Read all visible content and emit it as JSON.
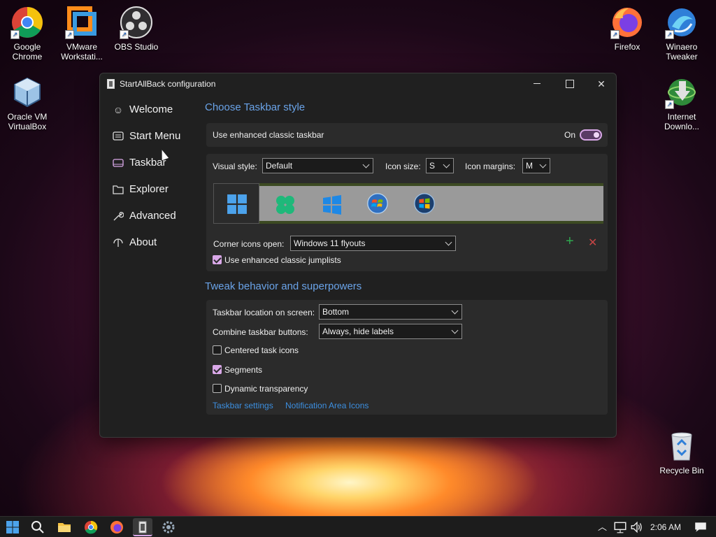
{
  "desktop": {
    "icons": [
      {
        "label": "Google Chrome"
      },
      {
        "label": "VMware Workstati..."
      },
      {
        "label": "OBS Studio"
      },
      {
        "label": "Oracle VM VirtualBox"
      },
      {
        "label": "Firefox"
      },
      {
        "label": "Winaero Tweaker"
      },
      {
        "label": "Internet Downlo..."
      },
      {
        "label": "Recycle Bin"
      }
    ]
  },
  "window": {
    "title": "StartAllBack configuration"
  },
  "sidebar": {
    "items": [
      {
        "label": "Welcome",
        "icon": "smile-icon"
      },
      {
        "label": "Start Menu",
        "icon": "start-menu-icon"
      },
      {
        "label": "Taskbar",
        "icon": "taskbar-icon"
      },
      {
        "label": "Explorer",
        "icon": "folder-icon"
      },
      {
        "label": "Advanced",
        "icon": "wrench-icon"
      },
      {
        "label": "About",
        "icon": "about-icon"
      }
    ],
    "selected": "Taskbar"
  },
  "style_section": {
    "title": "Choose Taskbar style",
    "enhanced_label": "Use enhanced classic taskbar",
    "enhanced_state": "On",
    "visual_style_label": "Visual style:",
    "visual_style_value": "Default",
    "icon_size_label": "Icon size:",
    "icon_size_value": "S",
    "icon_margins_label": "Icon margins:",
    "icon_margins_value": "M",
    "corner_label": "Corner icons open:",
    "corner_value": "Windows 11 flyouts",
    "add_symbol": "+",
    "remove_symbol": "✕",
    "jumplists_label": "Use enhanced classic jumplists",
    "jumplists_checked": true
  },
  "tweak_section": {
    "title": "Tweak behavior and superpowers",
    "location_label": "Taskbar location on screen:",
    "location_value": "Bottom",
    "combine_label": "Combine taskbar buttons:",
    "combine_value": "Always, hide labels",
    "centered_label": "Centered task icons",
    "centered_checked": false,
    "segments_label": "Segments",
    "segments_checked": true,
    "transparency_label": "Dynamic transparency",
    "transparency_checked": false,
    "link_taskbar_settings": "Taskbar settings",
    "link_notification": "Notification Area Icons"
  },
  "taskbar": {
    "time": "2:06 AM"
  },
  "colors": {
    "accent": "#d9a8e8",
    "link": "#3c8fe0",
    "section_title": "#6aa3e8"
  }
}
